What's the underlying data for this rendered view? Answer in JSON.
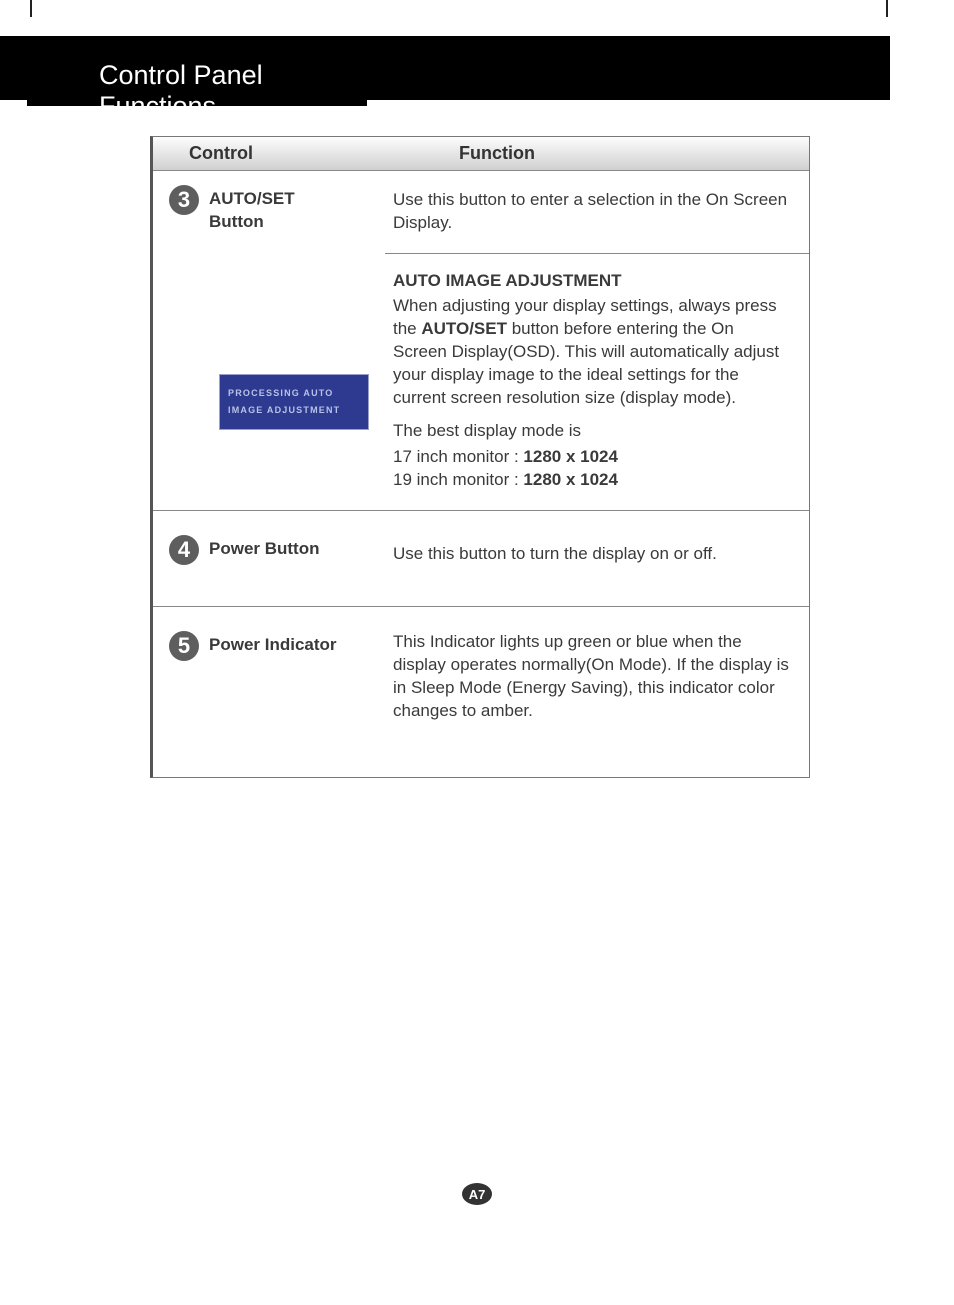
{
  "header": {
    "title": "Control Panel Functions"
  },
  "table": {
    "headers": {
      "control": "Control",
      "function": "Function"
    },
    "row3": {
      "num": "3",
      "label_line1": "AUTO/SET",
      "label_line2": "Button",
      "func1": "Use this button to enter a selection in the On Screen Display.",
      "func2_title": "AUTO IMAGE ADJUSTMENT",
      "func2_body_a": "When adjusting your display settings, always press the ",
      "func2_body_bold": "AUTO/SET",
      "func2_body_b": " button before entering the On Screen Display(OSD). This will automatically adjust your display image to the ideal settings for the current screen resolution size (display mode).",
      "func2_best": "The best display mode is",
      "func2_mode17_a": "17 inch monitor : ",
      "func2_mode17_b": "1280 x 1024",
      "func2_mode19_a": "19 inch monitor : ",
      "func2_mode19_b": "1280 x 1024",
      "bluebox_line1": "PROCESSING AUTO",
      "bluebox_line2": "IMAGE ADJUSTMENT"
    },
    "row4": {
      "num": "4",
      "label": "Power Button",
      "func": "Use this button to turn the display on or off."
    },
    "row5": {
      "num": "5",
      "label": "Power Indicator",
      "func": "This Indicator lights up green or blue when the display operates normally(On Mode). If the display is in Sleep Mode (Energy Saving), this indicator color changes to amber."
    }
  },
  "page_number": "A7"
}
